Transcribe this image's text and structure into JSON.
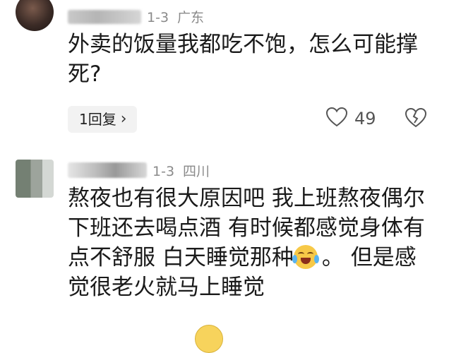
{
  "comments": [
    {
      "username": "",
      "date": "1-3",
      "location": "广东",
      "text": "外卖的饭量我都吃不饱，怎么可能撑死?",
      "reply_label": "1回复",
      "likes": "49"
    },
    {
      "username": "",
      "date": "1-3",
      "location": "四川",
      "text": "熬夜也有很大原因吧 我上班熬夜偶尔下班还去喝点酒 有时候都感觉身体有点不舒服 白天睡觉那种",
      "text2": "。 但是感觉很老火就马上睡觉"
    }
  ]
}
